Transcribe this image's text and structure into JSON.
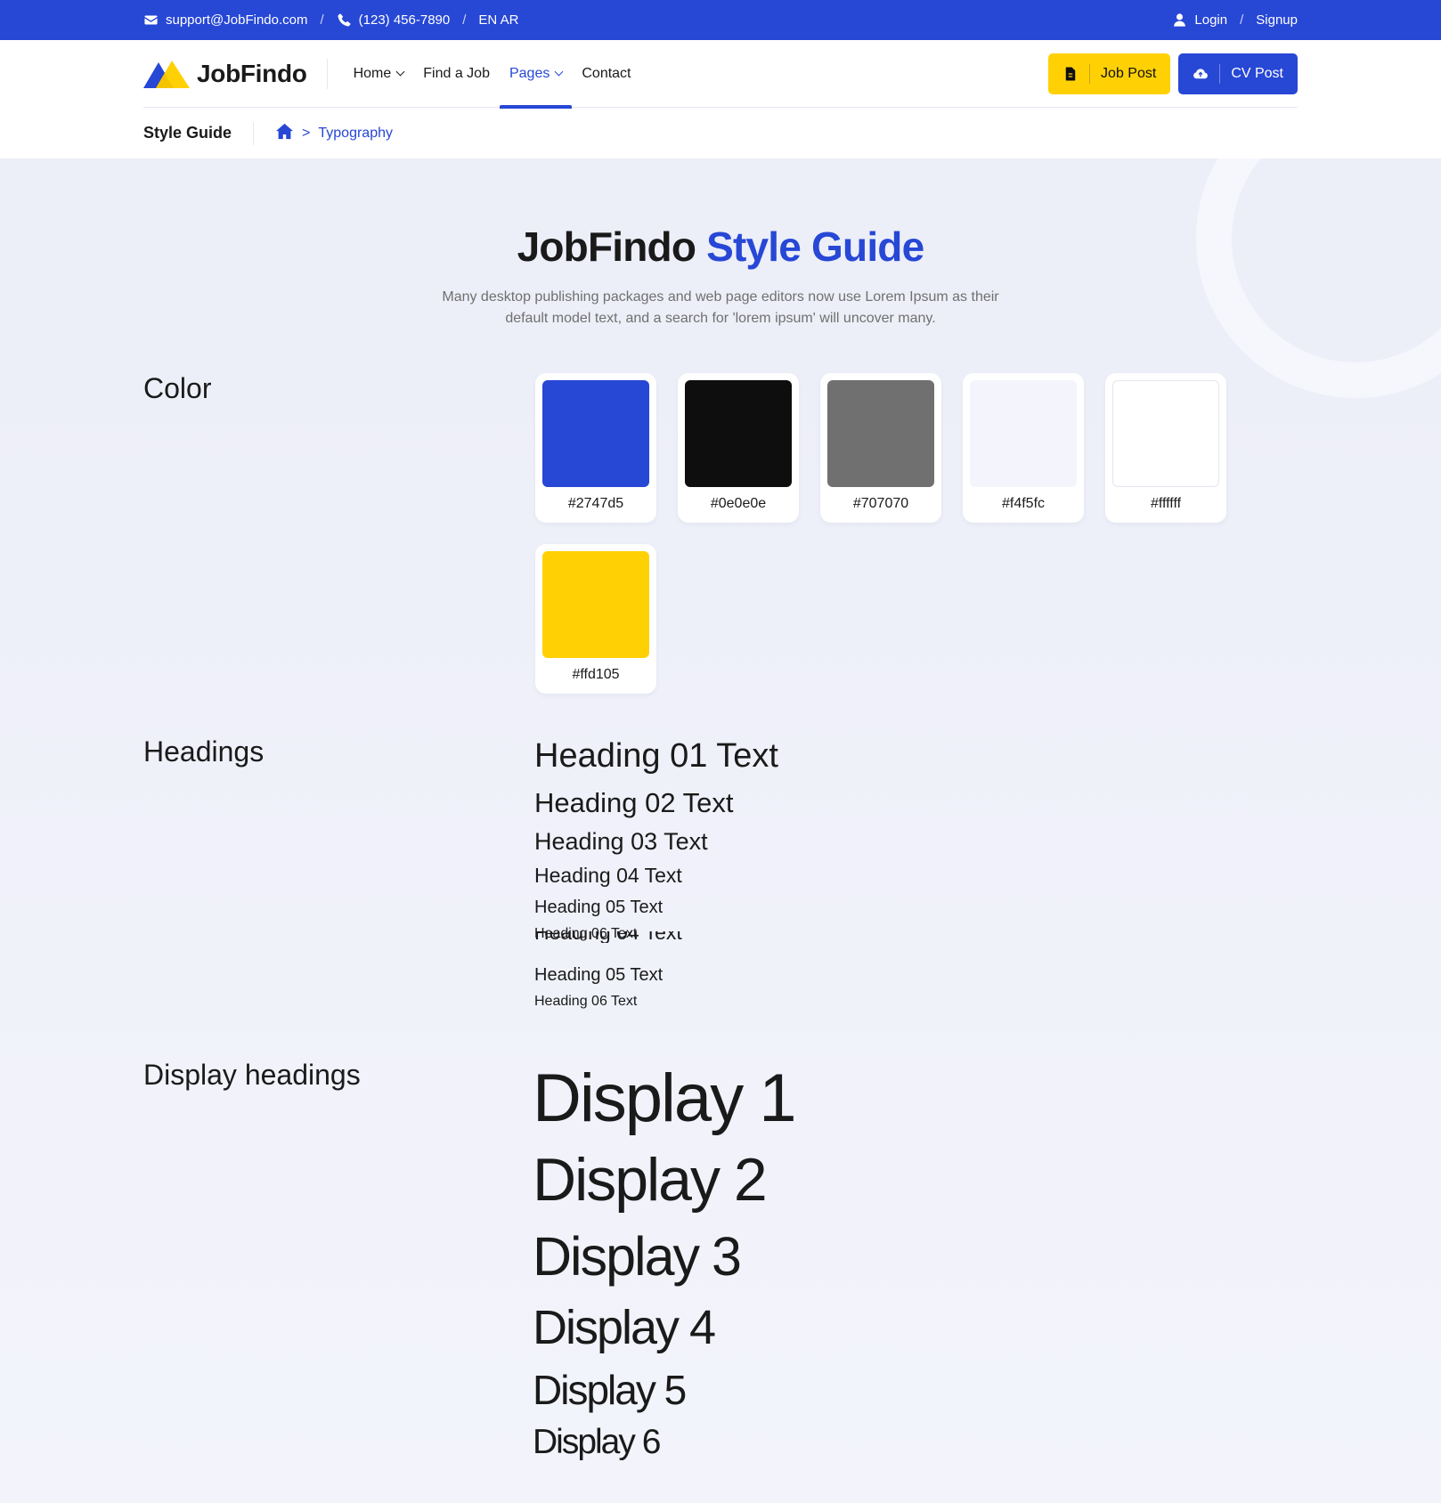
{
  "topbar": {
    "email": "support@JobFindo.com",
    "phone": "(123) 456-7890",
    "lang": "EN AR",
    "sep": "/",
    "login": "Login",
    "signup": "Signup"
  },
  "brand": {
    "name": "JobFindo"
  },
  "nav": {
    "items": [
      {
        "label": "Home",
        "dropdown": true
      },
      {
        "label": "Find a Job",
        "dropdown": false
      },
      {
        "label": "Pages",
        "dropdown": true,
        "active": true
      },
      {
        "label": "Contact",
        "dropdown": false
      }
    ]
  },
  "actions": {
    "job_post": "Job Post",
    "cv_post": "CV Post"
  },
  "breadcrumb": {
    "title": "Style Guide",
    "sep": ">",
    "current": "Typography"
  },
  "hero": {
    "title_main": "JobFindo",
    "title_accent": "Style Guide",
    "subtitle": "Many desktop publishing packages and web page editors now use Lorem Ipsum as their default model text, and a search for 'lorem ipsum' will uncover many."
  },
  "sections": {
    "color": "Color",
    "headings": "Headings",
    "display": "Display headings"
  },
  "colors": [
    {
      "hex": "#2747d5",
      "label": "#2747d5"
    },
    {
      "hex": "#0e0e0e",
      "label": "#0e0e0e"
    },
    {
      "hex": "#707070",
      "label": "#707070"
    },
    {
      "hex": "#f4f5fc",
      "label": "#f4f5fc"
    },
    {
      "hex": "#ffffff",
      "label": "#ffffff"
    },
    {
      "hex": "#ffd105",
      "label": "#ffd105"
    }
  ],
  "headings": {
    "h1": "Heading 01 Text",
    "h2": "Heading 02 Text",
    "h3": "Heading 03 Text",
    "h4": "Heading 04 Text",
    "h5": "Heading 05 Text",
    "h6": "Heading 06 Text",
    "h4_overlap": "Heading 04 Text",
    "h5_repeat": "Heading 05 Text",
    "h6_repeat": "Heading 06 Text"
  },
  "displays": [
    "Display 1",
    "Display 2",
    "Display 3",
    "Display 4",
    "Display 5",
    "Display 6"
  ],
  "accent": "#2747d5",
  "accent_yellow": "#ffd105"
}
